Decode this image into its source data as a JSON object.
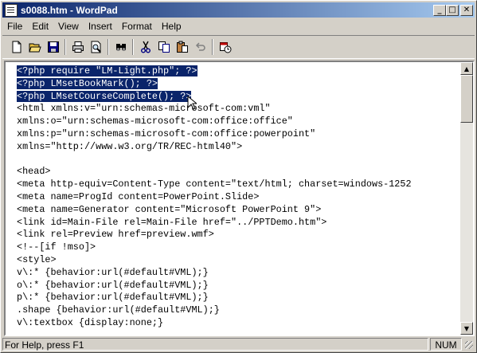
{
  "window": {
    "title": "s0088.htm - WordPad",
    "minimize_glyph": "_",
    "maximize_glyph": "□",
    "close_glyph": "✕"
  },
  "menu": [
    "File",
    "Edit",
    "View",
    "Insert",
    "Format",
    "Help"
  ],
  "toolbar_icons": [
    "new-icon",
    "open-icon",
    "save-icon",
    "print-icon",
    "print-preview-icon",
    "find-icon",
    "cut-icon",
    "copy-icon",
    "paste-icon",
    "undo-icon",
    "insert-datetime-icon"
  ],
  "document": {
    "lines": [
      {
        "text": "<?php require \"LM-Light.php\"; ?>",
        "selected": true
      },
      {
        "text": "<?php LMsetBookMark(); ?>",
        "selected": true
      },
      {
        "text": "<?php LMsetCourseComplete(); ?>",
        "selected": true
      },
      {
        "text": "<html xmlns:v=\"urn:schemas-microsoft-com:vml\"",
        "selected": false
      },
      {
        "text": "xmlns:o=\"urn:schemas-microsoft-com:office:office\"",
        "selected": false
      },
      {
        "text": "xmlns:p=\"urn:schemas-microsoft-com:office:powerpoint\"",
        "selected": false
      },
      {
        "text": "xmlns=\"http://www.w3.org/TR/REC-html40\">",
        "selected": false
      },
      {
        "text": "",
        "selected": false
      },
      {
        "text": "<head>",
        "selected": false
      },
      {
        "text": "<meta http-equiv=Content-Type content=\"text/html; charset=windows-1252",
        "selected": false
      },
      {
        "text": "<meta name=ProgId content=PowerPoint.Slide>",
        "selected": false
      },
      {
        "text": "<meta name=Generator content=\"Microsoft PowerPoint 9\">",
        "selected": false
      },
      {
        "text": "<link id=Main-File rel=Main-File href=\"../PPTDemo.htm\">",
        "selected": false
      },
      {
        "text": "<link rel=Preview href=preview.wmf>",
        "selected": false
      },
      {
        "text": "<!--[if !mso]>",
        "selected": false
      },
      {
        "text": "<style>",
        "selected": false
      },
      {
        "text": "v\\:* {behavior:url(#default#VML);}",
        "selected": false
      },
      {
        "text": "o\\:* {behavior:url(#default#VML);}",
        "selected": false
      },
      {
        "text": "p\\:* {behavior:url(#default#VML);}",
        "selected": false
      },
      {
        "text": ".shape {behavior:url(#default#VML);}",
        "selected": false
      },
      {
        "text": "v\\:textbox {display:none;}",
        "selected": false
      }
    ]
  },
  "status": {
    "help_text": "For Help, press F1",
    "num": "NUM"
  },
  "colors": {
    "selection": "#0a246a",
    "title_start": "#0a246a",
    "title_end": "#a6caf0"
  }
}
